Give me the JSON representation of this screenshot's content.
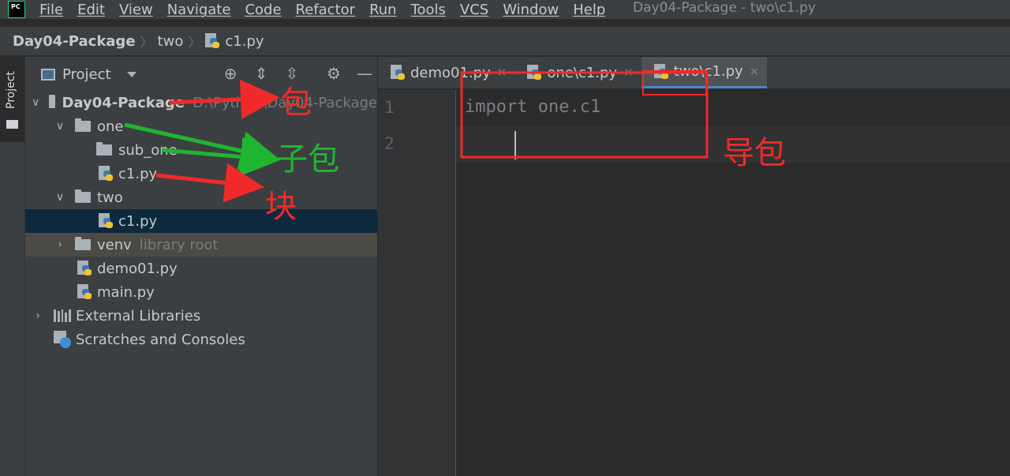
{
  "menu": {
    "logo": "PC",
    "items": [
      "File",
      "Edit",
      "View",
      "Navigate",
      "Code",
      "Refactor",
      "Run",
      "Tools",
      "VCS",
      "Window",
      "Help"
    ],
    "window_title": "Day04-Package - two\\c1.py"
  },
  "breadcrumb": {
    "project": "Day04-Package",
    "folder": "two",
    "file": "c1.py"
  },
  "stripe": {
    "label": "Project"
  },
  "project_panel": {
    "title": "Project",
    "tools": [
      "locate-icon",
      "expand-all-icon",
      "collapse-all-icon",
      "gear-icon",
      "minimize-icon"
    ]
  },
  "tree": {
    "root_name": "Day04-Package",
    "root_path": "D:\\Python\\Day04-Package",
    "one": "one",
    "sub_one": "sub_one",
    "one_c1": "c1.py",
    "two": "two",
    "two_c1": "c1.py",
    "venv": "venv",
    "venv_hint": "library root",
    "demo01": "demo01.py",
    "main": "main.py",
    "external_libraries": "External Libraries",
    "scratches": "Scratches and Consoles"
  },
  "tabs": [
    {
      "label": "demo01.py",
      "active": false
    },
    {
      "label": "one\\c1.py",
      "active": false
    },
    {
      "label": "two\\c1.py",
      "active": true
    }
  ],
  "editor": {
    "line_numbers": [
      "1",
      "2"
    ],
    "lines": [
      "import one.c1",
      ""
    ]
  },
  "annotations": {
    "package": "包",
    "subpackage": "子包",
    "module": "块",
    "import_package": "导包",
    "red": "#f02a2a",
    "green": "#1fb530"
  },
  "colors": {
    "background": "#2b2b2b",
    "panel": "#3c3f41",
    "selection": "#0d293e",
    "accent": "#4a88c7"
  }
}
